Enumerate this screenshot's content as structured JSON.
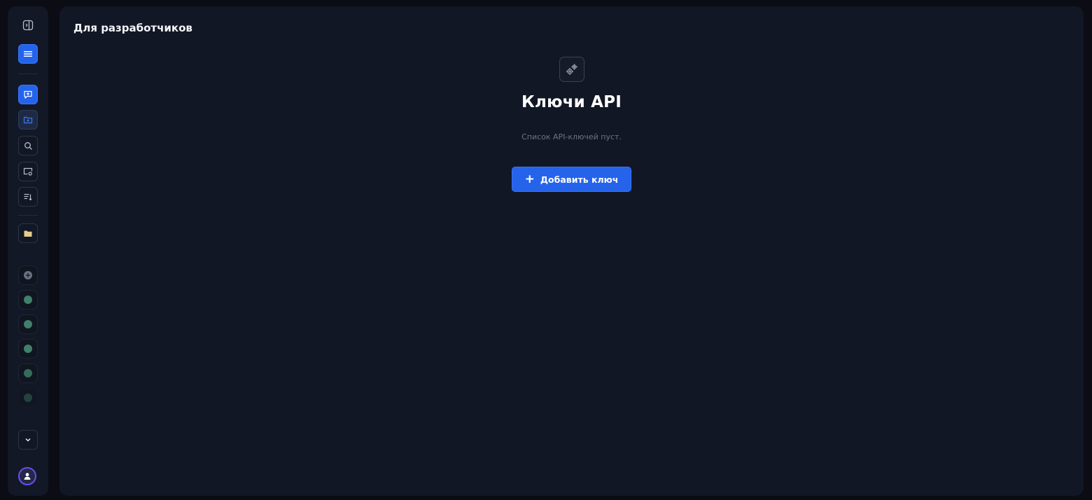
{
  "page": {
    "title": "Для разработчиков"
  },
  "empty_state": {
    "icon": "gears-icon",
    "title": "Ключи API",
    "subtitle": "Список API-ключей пуст.",
    "add_button_label": "Добавить ключ",
    "add_button_icon": "plus-icon"
  },
  "sidebar": {
    "toggle_icon": "sidebar-toggle-icon",
    "menu_icon": "menu-icon",
    "nav": [
      {
        "icon": "new-chat-icon",
        "state": "primary"
      },
      {
        "icon": "folder-add-icon",
        "state": "active"
      },
      {
        "icon": "search-icon",
        "state": "default"
      },
      {
        "icon": "screen-settings-icon",
        "state": "default"
      },
      {
        "icon": "list-sort-icon",
        "state": "default"
      }
    ],
    "folder_icon": "folder-icon",
    "expand_icon": "chevron-down-icon",
    "avatar_icon": "user-icon"
  },
  "colors": {
    "accent": "#2563eb",
    "background": "#0b0c14",
    "panel": "#121726",
    "text_muted": "#6b7488",
    "folder": "#e6cc8c",
    "model_dot": "#4a8f7a"
  }
}
